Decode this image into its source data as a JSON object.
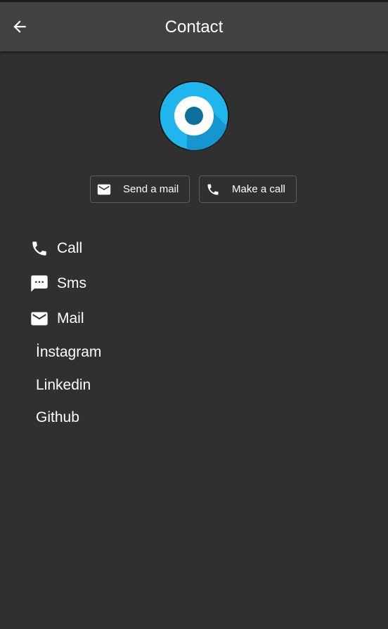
{
  "appbar": {
    "title": "Contact"
  },
  "actions": {
    "mail_label": "Send a mail",
    "call_label": "Make a call"
  },
  "list": {
    "call": "Call",
    "sms": "Sms",
    "mail": "Mail",
    "instagram": "İnstagram",
    "linkedin": "Linkedin",
    "github": "Github"
  },
  "colors": {
    "background": "#303030",
    "appbar": "#424242",
    "avatar_blue": "#1fb6ee",
    "avatar_inner": "#0c6f9c"
  },
  "icons": [
    "back-arrow-icon",
    "mail-icon",
    "phone-icon",
    "sms-icon"
  ]
}
